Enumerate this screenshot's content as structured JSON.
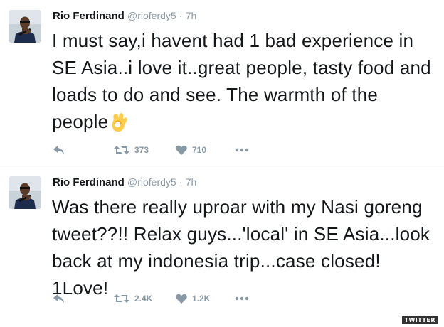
{
  "tweets": [
    {
      "author": {
        "name": "Rio Ferdinand",
        "handle": "@rioferdy5",
        "time": "7h"
      },
      "text": "I must say,i havent had 1 bad experience in SE Asia..i love it..great people, tasty food and loads to do and see. The warmth of the people",
      "emoji": "ok-hand-icon",
      "retweets": "373",
      "likes": "710"
    },
    {
      "author": {
        "name": "Rio Ferdinand",
        "handle": "@rioferdy5",
        "time": "7h"
      },
      "text": "Was there really uproar with my Nasi goreng tweet??!! Relax guys...'local' in SE Asia...look back at my indonesia trip...case closed! 1Love!",
      "retweets": "2.4K",
      "likes": "1.2K"
    }
  ],
  "separator": "·",
  "watermark": "TWITTER",
  "colors": {
    "text": "#14171a",
    "muted": "#8899a6",
    "divider": "#e6ecf0",
    "emoji": "#ffcc4d"
  }
}
